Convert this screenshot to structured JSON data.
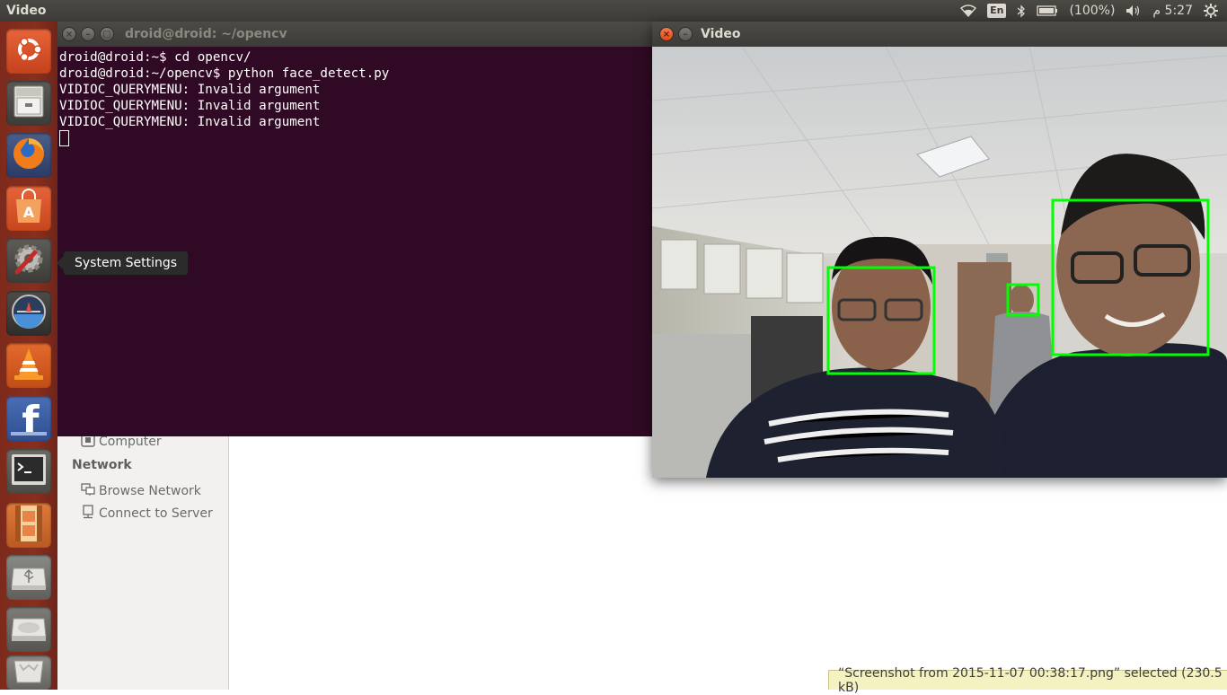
{
  "top_panel": {
    "app_title": "Video",
    "keyboard_layout": "En",
    "battery_text": "(100%)",
    "time_text": "5:27 م",
    "icons": [
      "wifi-icon",
      "bluetooth-icon",
      "battery-icon",
      "volume-icon",
      "settings-gear-icon"
    ]
  },
  "launcher": {
    "items": [
      {
        "name": "ubuntu-dash",
        "icon": "ubuntu-logo-icon"
      },
      {
        "name": "files",
        "icon": "file-cabinet-icon",
        "running": true
      },
      {
        "name": "firefox",
        "icon": "firefox-icon"
      },
      {
        "name": "software-center",
        "icon": "shopping-bag-icon"
      },
      {
        "name": "system-settings",
        "icon": "wrench-gear-icon"
      },
      {
        "name": "unknown-gauge",
        "icon": "gauge-icon"
      },
      {
        "name": "vlc",
        "icon": "vlc-cone-icon"
      },
      {
        "name": "facebook",
        "icon": "facebook-icon"
      },
      {
        "name": "terminal",
        "icon": "terminal-icon",
        "running": true
      },
      {
        "name": "videos",
        "icon": "film-strip-icon",
        "running": true
      },
      {
        "name": "usb-drive",
        "icon": "usb-drive-icon"
      },
      {
        "name": "hard-drive",
        "icon": "hard-drive-icon"
      },
      {
        "name": "trash",
        "icon": "trash-icon"
      }
    ],
    "tooltip": "System Settings"
  },
  "terminal": {
    "title": "droid@droid: ~/opencv",
    "lines": [
      "droid@droid:~$ cd opencv/",
      "droid@droid:~/opencv$ python face_detect.py",
      "VIDIOC_QUERYMENU: Invalid argument",
      "VIDIOC_QUERYMENU: Invalid argument",
      "VIDIOC_QUERYMENU: Invalid argument"
    ]
  },
  "file_manager": {
    "computer_label": "Computer",
    "network_heading": "Network",
    "browse_network": "Browse Network",
    "connect_to_server": "Connect to Server",
    "status_text": "“Screenshot from 2015-11-07 00:38:17.png” selected  (230.5 kB)"
  },
  "video_window": {
    "title": "Video",
    "detection_box_color": "#00ff00"
  },
  "colors": {
    "terminal_bg": "#300a24",
    "launcher_bg": "#882f1f",
    "panel_bg": "#3c3b37",
    "close_button": "#df4a16"
  }
}
